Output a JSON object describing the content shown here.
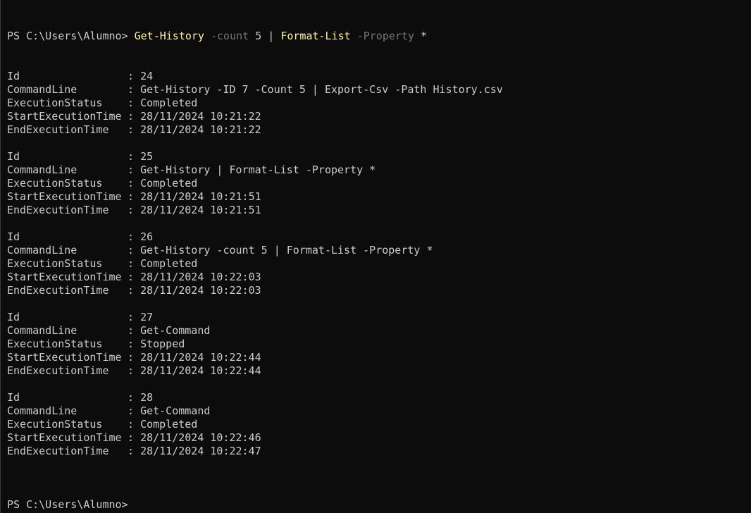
{
  "prompt_1": {
    "prefix": "PS C:\\Users\\Alumno> ",
    "cmd1": "Get-History",
    "param1": " -count",
    "val1": " 5 ",
    "pipe": "|",
    "cmd2": " Format-List",
    "param2": " -Property",
    "val2": " *"
  },
  "labels": {
    "id": "Id",
    "commandline": "CommandLine",
    "status": "ExecutionStatus",
    "start": "StartExecutionTime",
    "end": "EndExecutionTime"
  },
  "separator": ": ",
  "records": [
    {
      "id": "24",
      "commandline": "Get-History -ID 7 -Count 5 | Export-Csv -Path History.csv",
      "status": "Completed",
      "start": "28/11/2024 10:21:22",
      "end": "28/11/2024 10:21:22"
    },
    {
      "id": "25",
      "commandline": "Get-History | Format-List -Property *",
      "status": "Completed",
      "start": "28/11/2024 10:21:51",
      "end": "28/11/2024 10:21:51"
    },
    {
      "id": "26",
      "commandline": "Get-History -count 5 | Format-List -Property *",
      "status": "Completed",
      "start": "28/11/2024 10:22:03",
      "end": "28/11/2024 10:22:03"
    },
    {
      "id": "27",
      "commandline": "Get-Command",
      "status": "Stopped",
      "start": "28/11/2024 10:22:44",
      "end": "28/11/2024 10:22:44"
    },
    {
      "id": "28",
      "commandline": "Get-Command",
      "status": "Completed",
      "start": "28/11/2024 10:22:46",
      "end": "28/11/2024 10:22:47"
    }
  ],
  "prompt_2": {
    "prefix": "PS C:\\Users\\Alumno> "
  },
  "colors": {
    "background": "#0c0c0c",
    "foreground": "#cccccc",
    "command": "#f9f1a5",
    "parameter": "#767676"
  }
}
